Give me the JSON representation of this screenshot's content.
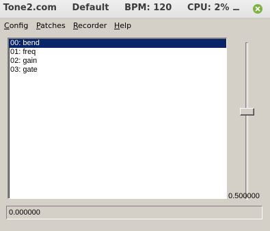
{
  "window": {
    "title": "Tone2.com     Default     BPM: 120     CPU: 2%",
    "minimize_icon": "minimize-icon",
    "close_icon": "close-icon",
    "close_color": "#7cb342"
  },
  "menu": {
    "items": [
      {
        "accel": "C",
        "rest": "onfig"
      },
      {
        "accel": "P",
        "rest": "atches"
      },
      {
        "accel": "R",
        "rest": "ecorder"
      },
      {
        "accel": "H",
        "rest": "elp"
      }
    ]
  },
  "parameters": {
    "items": [
      {
        "label": "00: bend",
        "selected": true
      },
      {
        "label": "01: freq",
        "selected": false
      },
      {
        "label": "02: gain",
        "selected": false
      },
      {
        "label": "03: gate",
        "selected": false
      }
    ],
    "selection_color": "#0a246a"
  },
  "slider": {
    "value_text": "0.500000",
    "level": 0.5
  },
  "status": {
    "text": "0.000000"
  }
}
